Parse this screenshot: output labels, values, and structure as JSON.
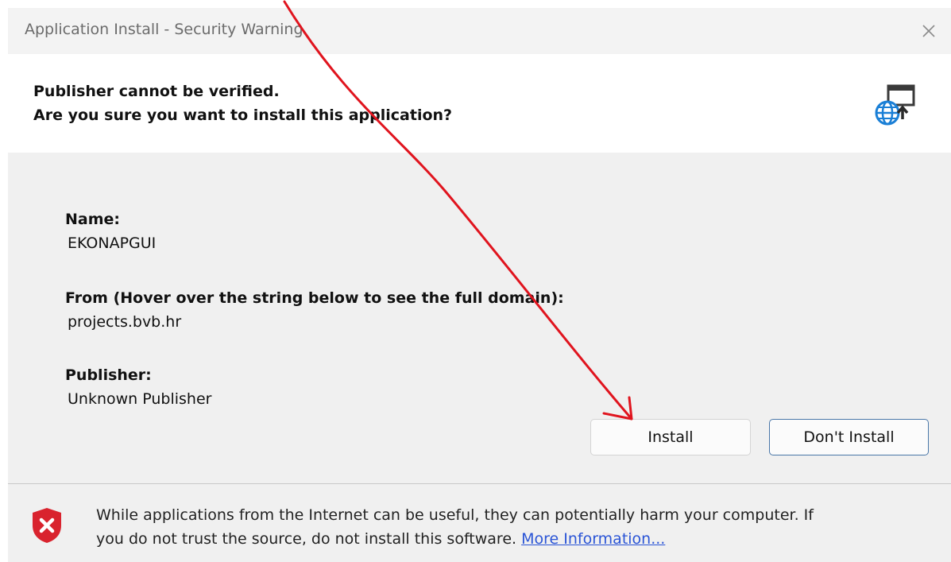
{
  "window": {
    "title": "Application Install - Security Warning",
    "close_glyph": "×"
  },
  "header": {
    "line1": "Publisher cannot be verified.",
    "line2": "Are you sure you want to install this application?",
    "icon": "globe-install-icon"
  },
  "details": {
    "name_label": "Name:",
    "name_value": "EKONAPGUI",
    "from_label": "From (Hover over the string below to see the full domain):",
    "from_value": "projects.bvb.hr",
    "publisher_label": "Publisher:",
    "publisher_value": "Unknown Publisher"
  },
  "buttons": {
    "install": "Install",
    "dont_install": "Don't Install"
  },
  "footer": {
    "icon": "shield-warning-icon",
    "line1": "While applications from the Internet can be useful, they can potentially harm your computer. If",
    "line2_prefix": "you do not trust the source, do not install this software. ",
    "more_link": "More Information..."
  },
  "annotation": {
    "icon": "red-arrow-annotation",
    "color": "#e0141e"
  },
  "colors": {
    "accent_border": "#4a77a8",
    "link": "#2b55d6",
    "shield_red": "#d9232e",
    "icon_blue": "#1a7fd6"
  }
}
